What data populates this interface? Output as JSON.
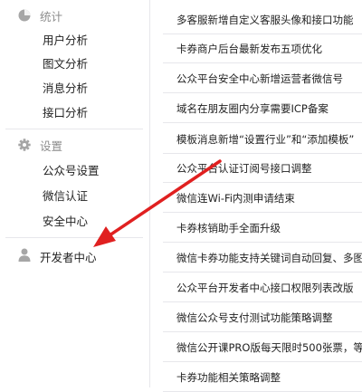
{
  "sidebar": {
    "stats": {
      "title": "统计",
      "icon": "pie-chart-icon",
      "items": [
        "用户分析",
        "图文分析",
        "消息分析",
        "接口分析"
      ]
    },
    "settings": {
      "title": "设置",
      "icon": "gear-icon",
      "items": [
        "公众号设置",
        "微信认证",
        "安全中心"
      ]
    },
    "developer": {
      "label": "开发者中心",
      "icon": "person-icon"
    }
  },
  "announcements": [
    "多客服新增自定义客服头像和接口功能",
    "卡券商户后台最新发布五项优化",
    "公众平台安全中心新增运营者微信号",
    "域名在朋友圈内分享需要ICP备案",
    "模板消息新增“设置行业”和“添加模板”",
    "公众平台认证订阅号接口调整",
    "微信连Wi-Fi内测申请结束",
    "卡券核销助手全面升级",
    "微信卡券功能支持关键词自动回复、多图文",
    "公众平台开发者中心接口权限列表改版",
    "微信公众号支付测试功能策略调整",
    "微信公开课PRO版每天限时500张票，等你",
    "卡券功能相关策略调整"
  ],
  "colors": {
    "annotation_arrow": "#e02020",
    "icon_gray": "#a6a6a6",
    "divider": "#e7e7eb"
  }
}
